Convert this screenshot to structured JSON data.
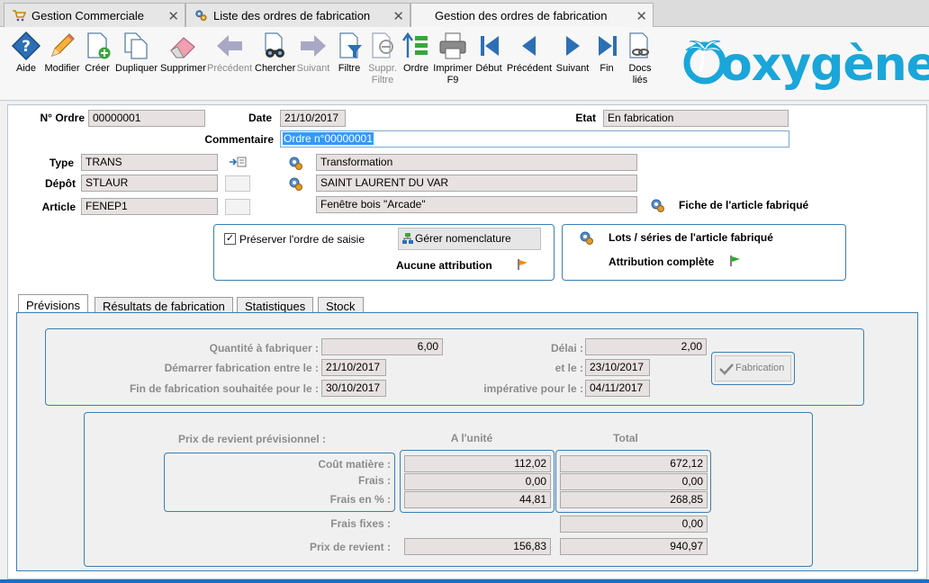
{
  "tabs": [
    {
      "label": "Gestion Commerciale",
      "icon": "cart-icon"
    },
    {
      "label": "Liste des ordres de fabrication",
      "icon": "gears-icon"
    },
    {
      "label": "Gestion des ordres de fabrication",
      "icon": ""
    }
  ],
  "toolbar": {
    "aide": "Aide",
    "modifier": "Modifier",
    "creer": "Créer",
    "dupliquer": "Dupliquer",
    "supprimer": "Supprimer",
    "precedent": "Précédent",
    "chercher": "Chercher",
    "suivant": "Suivant",
    "filtre": "Filtre",
    "suppr_filtre_1": "Suppr.",
    "suppr_filtre_2": "Filtre",
    "ordre": "Ordre",
    "imprimer_1": "Imprimer",
    "imprimer_2": "F9",
    "debut": "Début",
    "precedent2": "Précédent",
    "suivant2": "Suivant",
    "fin": "Fin",
    "docs_1": "Docs",
    "docs_2": "liés"
  },
  "brand": {
    "logo_text": "oxygène",
    "color": "#1aa6d9"
  },
  "header": {
    "no_ordre_label": "N° Ordre",
    "no_ordre": "00000001",
    "date_label": "Date",
    "date": "21/10/2017",
    "etat_label": "Etat",
    "etat": "En fabrication",
    "commentaire_label": "Commentaire",
    "commentaire": "Ordre n°00000001",
    "type_label": "Type",
    "type": "TRANS",
    "type_desc": "Transformation",
    "depot_label": "Dépôt",
    "depot": "STLAUR",
    "depot_desc": "SAINT LAURENT DU VAR",
    "article_label": "Article",
    "article": "FENEP1",
    "article_desc": "Fenêtre bois \"Arcade\"",
    "fiche_article": "Fiche de l'article fabriqué"
  },
  "options": {
    "preserver_label": "Préserver l'ordre de saisie",
    "preserver_checked": true,
    "gerer_nomenclature": "Gérer nomenclature",
    "aucune_attribution": "Aucune attribution",
    "lots_series": "Lots / séries de l'article fabriqué",
    "attribution_complete": "Attribution complète"
  },
  "inner_tabs": [
    "Prévisions",
    "Résultats de fabrication",
    "Statistiques",
    "Stock"
  ],
  "previsions": {
    "qte_label": "Quantité à fabriquer :",
    "qte": "6,00",
    "delai_label": "Délai :",
    "delai": "2,00",
    "demarrer_label": "Démarrer fabrication entre le :",
    "demarrer": "21/10/2017",
    "et_le_label": "et le :",
    "et_le": "23/10/2017",
    "fin_label": "Fin de fabrication souhaitée pour le :",
    "fin": "30/10/2017",
    "imperative_label": "impérative pour le :",
    "imperative": "04/11/2017",
    "fabrication_btn": "Fabrication"
  },
  "costs": {
    "title": "Prix de revient prévisionnel :",
    "col_unit": "A l'unité",
    "col_total": "Total",
    "cout_matiere_label": "Coût matière :",
    "cout_matiere_unit": "112,02",
    "cout_matiere_total": "672,12",
    "frais_label": "Frais :",
    "frais_unit": "0,00",
    "frais_total": "0,00",
    "frais_pct_label": "Frais en % :",
    "frais_pct_unit": "44,81",
    "frais_pct_total": "268,85",
    "frais_fixes_label": "Frais fixes :",
    "frais_fixes_total": "0,00",
    "prix_revient_label": "Prix de revient :",
    "prix_revient_unit": "156,83",
    "prix_revient_total": "940,97"
  }
}
